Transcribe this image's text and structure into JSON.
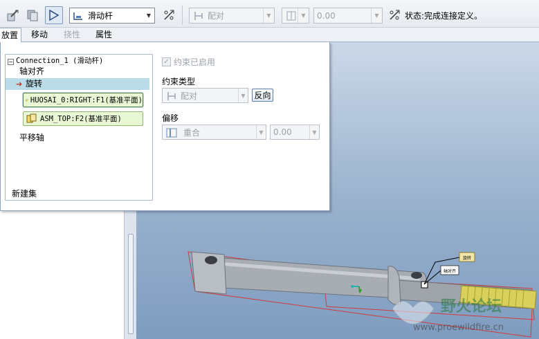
{
  "toolbar": {
    "connection_type": "滑动杆",
    "constraint_type_combo": "配对",
    "offset_value": "0.00",
    "status_label": "状态:完成连接定义。"
  },
  "tabs": [
    {
      "label": "放置",
      "selected": true
    },
    {
      "label": "移动"
    },
    {
      "label": "挠性",
      "disabled": true
    },
    {
      "label": "属性"
    }
  ],
  "panel": {
    "tree": {
      "root": "Connection_1 (滑动杆)",
      "items": [
        {
          "label": "轴对齐"
        },
        {
          "label": "旋转",
          "selected": true
        },
        {
          "label": "HUOSAI_0:RIGHT:F1(基准平面)",
          "ref": true
        },
        {
          "label": "ASM_TOP:F2(基准平面)",
          "ref": true
        },
        {
          "label": "平移轴"
        }
      ],
      "new_set": "新建集"
    },
    "constraint_enabled": "约束已启用",
    "constraint_type_label": "约束类型",
    "constraint_type_value": "配对",
    "flip_button": "反向",
    "offset_label": "偏移",
    "offset_type_value": "重合",
    "offset_value": "0.00"
  },
  "model": {
    "tag_rotation": "旋转",
    "tag_axis_align": "轴对齐"
  },
  "watermark": {
    "text": "野火论坛",
    "url": "www.proewildfire.cn"
  }
}
